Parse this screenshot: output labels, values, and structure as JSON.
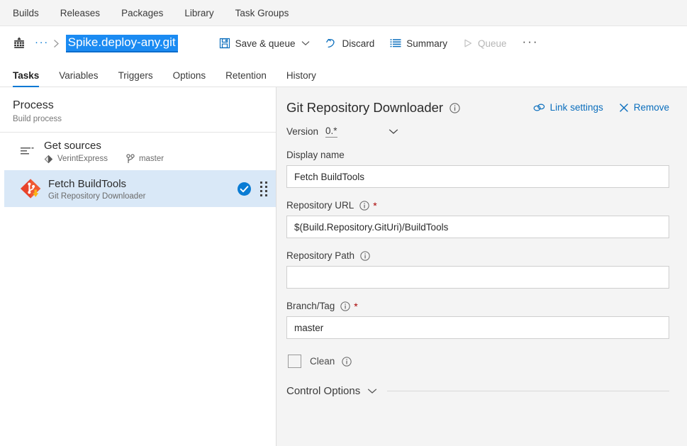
{
  "topnav": {
    "items": [
      {
        "label": "Builds"
      },
      {
        "label": "Releases"
      },
      {
        "label": "Packages"
      },
      {
        "label": "Library"
      },
      {
        "label": "Task Groups"
      }
    ]
  },
  "breadcrumb": {
    "build_icon": "build-definition-icon",
    "ellipsis": "···",
    "separator": "›",
    "title": "Spike.deploy-any.git",
    "title_selected": true,
    "selection_color": "#1b8bf2"
  },
  "toolbar": {
    "save_queue_label": "Save & queue",
    "save_queue_icon": "save-icon",
    "discard_label": "Discard",
    "discard_icon": "undo-icon",
    "summary_label": "Summary",
    "summary_icon": "list-icon",
    "queue_label": "Queue",
    "queue_icon": "play-icon",
    "queue_disabled": true,
    "more_label": "···",
    "accent_color": "#0078d4"
  },
  "tabs": {
    "items": [
      {
        "label": "Tasks",
        "active": true
      },
      {
        "label": "Variables",
        "active": false
      },
      {
        "label": "Triggers",
        "active": false
      },
      {
        "label": "Options",
        "active": false
      },
      {
        "label": "Retention",
        "active": false
      },
      {
        "label": "History",
        "active": false
      }
    ],
    "active_underline_color": "#0078d4"
  },
  "sidebar": {
    "process_title": "Process",
    "process_subtitle": "Build process",
    "get_sources": {
      "name": "Get sources",
      "repo_label": "VerintExpress",
      "repo_icon": "tfvc-repo-icon",
      "branch_label": "master",
      "branch_icon": "branch-icon",
      "list_icon": "sources-list-icon"
    },
    "task": {
      "name": "Fetch BuildTools",
      "subtitle": "Git Repository Downloader",
      "icon": "git-download-icon",
      "enabled_badge": "check-circle-icon",
      "drag_handle": "drag-handle-icon",
      "selected": true,
      "selected_bg": "#d9e8f7"
    }
  },
  "detail": {
    "title": "Git Repository Downloader",
    "title_info_icon": "info-icon",
    "link_settings_label": "Link settings",
    "link_settings_icon": "link-icon",
    "remove_label": "Remove",
    "remove_icon": "close-icon",
    "version_label": "Version",
    "version_value": "0.*",
    "version_chevron": "chevron-down-icon",
    "fields": [
      {
        "label": "Display name",
        "value": "Fetch BuildTools",
        "placeholder": "",
        "required": false,
        "info": false
      },
      {
        "label": "Repository URL",
        "value": "$(Build.Repository.GitUri)/BuildTools",
        "placeholder": "",
        "required": true,
        "info": true
      },
      {
        "label": "Repository Path",
        "value": "",
        "placeholder": "",
        "required": false,
        "info": true
      },
      {
        "label": "Branch/Tag",
        "value": "master",
        "placeholder": "",
        "required": true,
        "info": true
      }
    ],
    "clean": {
      "label": "Clean",
      "checked": false,
      "info_icon": "info-icon"
    },
    "control_options": {
      "label": "Control Options",
      "chevron": "chevron-down-icon",
      "expanded": false
    },
    "required_marker": "*",
    "required_color": "#a80000",
    "link_color": "#0a6ebd"
  }
}
